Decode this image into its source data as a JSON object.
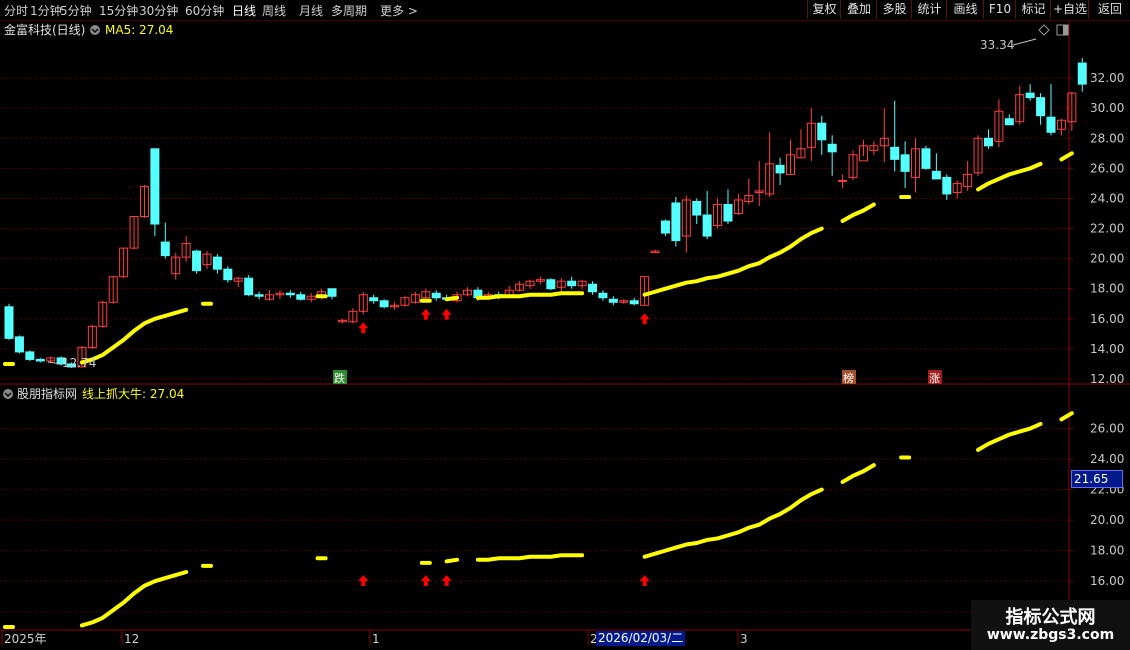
{
  "toolbar": {
    "tabs": [
      "分时",
      "1分钟",
      "5分钟",
      "15分钟",
      "30分钟",
      "60分钟",
      "日线",
      "周线",
      "月线",
      "多周期",
      "更多 >"
    ],
    "active_tab": "日线",
    "right_buttons": [
      "复权",
      "叠加",
      "多股",
      "统计",
      "画线",
      "F10",
      "标记",
      "+自选",
      "返回"
    ]
  },
  "main_panel": {
    "stock_title": "金富科技(日线)",
    "ma_label": "MA5: 27.04",
    "high_label": "33.34",
    "low_label": "12.74",
    "markers": [
      {
        "text": "跌",
        "color": "#2e8b2e"
      },
      {
        "text": "榜",
        "color": "#a0522d"
      },
      {
        "text": "涨",
        "color": "#a02020"
      }
    ]
  },
  "sub_panel": {
    "indicator_title": "股朋指标网",
    "line_label": "线上抓大牛: 27.04",
    "cursor_value": "21.65"
  },
  "x_axis": {
    "labels": [
      "2025年",
      "12",
      "1",
      "2",
      "3"
    ],
    "cursor_date": "2026/02/03/二"
  },
  "watermark": {
    "line1": "指标公式网",
    "line2": "www.zbgs3.com"
  },
  "colors": {
    "up": "#ff4040",
    "down": "#54ffff",
    "ma_line": "#ffff00",
    "signal": "#ff0000",
    "grid": "#5a0000"
  },
  "chart_data": [
    {
      "type": "candlestick",
      "title": "金富科技(日线)",
      "ylim": [
        11.8,
        34.4
      ],
      "y_ticks": [
        12.0,
        14.0,
        16.0,
        18.0,
        20.0,
        22.0,
        24.0,
        26.0,
        28.0,
        30.0,
        32.0
      ],
      "candles": [
        [
          16.8,
          14.7,
          17.0,
          14.6
        ],
        [
          14.8,
          13.8,
          14.9,
          13.7
        ],
        [
          13.8,
          13.3,
          13.9,
          13.2
        ],
        [
          13.3,
          13.2,
          13.4,
          13.1
        ],
        [
          13.2,
          13.4,
          13.5,
          13.1
        ],
        [
          13.4,
          13.0,
          13.5,
          12.9
        ],
        [
          13.0,
          12.8,
          13.1,
          12.74
        ],
        [
          12.8,
          14.1,
          14.2,
          12.8
        ],
        [
          14.1,
          15.5,
          15.6,
          14.0
        ],
        [
          15.5,
          17.1,
          17.2,
          15.4
        ],
        [
          17.1,
          18.8,
          18.8,
          17.0
        ],
        [
          18.8,
          20.7,
          20.7,
          18.7
        ],
        [
          20.7,
          22.8,
          22.8,
          20.6
        ],
        [
          22.8,
          24.8,
          24.9,
          22.7
        ],
        [
          27.3,
          22.3,
          27.3,
          21.5
        ],
        [
          21.1,
          20.2,
          22.4,
          20.0
        ],
        [
          19.0,
          20.1,
          20.4,
          18.6
        ],
        [
          20.1,
          21.0,
          21.5,
          19.8
        ],
        [
          20.5,
          19.2,
          20.6,
          19.0
        ],
        [
          19.6,
          20.3,
          20.5,
          19.3
        ],
        [
          20.1,
          19.3,
          20.3,
          19.0
        ],
        [
          19.3,
          18.6,
          19.5,
          18.4
        ],
        [
          18.5,
          18.7,
          18.8,
          18.1
        ],
        [
          18.7,
          17.6,
          18.9,
          17.5
        ],
        [
          17.6,
          17.5,
          17.8,
          17.3
        ],
        [
          17.3,
          17.6,
          17.9,
          17.2
        ],
        [
          17.6,
          17.7,
          17.9,
          17.3
        ],
        [
          17.7,
          17.6,
          17.9,
          17.4
        ],
        [
          17.6,
          17.3,
          17.8,
          17.2
        ],
        [
          17.3,
          17.5,
          17.7,
          17.1
        ],
        [
          17.5,
          17.8,
          18.0,
          17.3
        ],
        [
          18.0,
          17.5,
          18.0,
          17.3
        ],
        [
          15.8,
          15.9,
          16.0,
          15.7
        ],
        [
          15.8,
          16.5,
          16.7,
          15.7
        ],
        [
          16.5,
          17.6,
          17.8,
          16.3
        ],
        [
          17.4,
          17.2,
          17.6,
          17.0
        ],
        [
          17.2,
          16.8,
          17.3,
          16.7
        ],
        [
          16.8,
          16.9,
          17.1,
          16.6
        ],
        [
          16.9,
          17.4,
          17.5,
          16.8
        ],
        [
          17.1,
          17.6,
          17.8,
          17.0
        ],
        [
          17.4,
          17.8,
          18.0,
          17.2
        ],
        [
          17.7,
          17.4,
          17.9,
          17.2
        ],
        [
          17.4,
          17.3,
          17.6,
          17.2
        ],
        [
          17.2,
          17.6,
          17.8,
          17.1
        ],
        [
          17.6,
          17.9,
          18.1,
          17.5
        ],
        [
          17.9,
          17.4,
          18.1,
          17.2
        ],
        [
          17.5,
          17.6,
          17.8,
          17.3
        ],
        [
          17.6,
          17.5,
          17.8,
          17.3
        ],
        [
          17.5,
          17.9,
          18.2,
          17.4
        ],
        [
          17.9,
          18.3,
          18.5,
          17.8
        ],
        [
          18.2,
          18.5,
          18.6,
          18.0
        ],
        [
          18.5,
          18.6,
          18.8,
          18.3
        ],
        [
          18.6,
          18.0,
          18.7,
          17.9
        ],
        [
          18.1,
          18.5,
          18.7,
          17.8
        ],
        [
          18.5,
          18.2,
          18.8,
          18.0
        ],
        [
          18.2,
          18.5,
          18.6,
          18.0
        ],
        [
          18.3,
          17.8,
          18.5,
          17.6
        ],
        [
          17.7,
          17.4,
          17.9,
          17.2
        ],
        [
          17.3,
          17.1,
          17.5,
          16.9
        ],
        [
          17.1,
          17.2,
          17.3,
          17.0
        ],
        [
          17.2,
          17.0,
          17.4,
          16.9
        ],
        [
          16.9,
          18.8,
          18.8,
          16.9
        ],
        [
          20.4,
          20.5,
          20.6,
          20.4
        ],
        [
          22.5,
          21.7,
          22.6,
          21.5
        ],
        [
          23.7,
          21.2,
          24.1,
          20.8
        ],
        [
          21.5,
          23.9,
          24.2,
          20.4
        ],
        [
          23.8,
          22.9,
          24.0,
          22.3
        ],
        [
          22.9,
          21.5,
          24.5,
          21.3
        ],
        [
          22.2,
          23.6,
          24.0,
          22.0
        ],
        [
          23.6,
          22.5,
          24.6,
          22.3
        ],
        [
          23.0,
          23.9,
          24.3,
          22.9
        ],
        [
          23.8,
          24.2,
          25.3,
          23.6
        ],
        [
          24.4,
          24.5,
          26.5,
          23.5
        ],
        [
          24.3,
          26.3,
          28.4,
          24.1
        ],
        [
          26.2,
          25.7,
          26.7,
          24.9
        ],
        [
          25.6,
          26.9,
          27.9,
          25.6
        ],
        [
          26.7,
          27.3,
          28.6,
          26.7
        ],
        [
          27.4,
          29.0,
          30.0,
          26.5
        ],
        [
          29.0,
          27.9,
          29.5,
          26.9
        ],
        [
          27.6,
          27.1,
          28.2,
          25.5
        ],
        [
          25.2,
          25.2,
          25.6,
          24.7
        ],
        [
          25.4,
          26.9,
          27.2,
          25.2
        ],
        [
          26.5,
          27.5,
          27.9,
          26.8
        ],
        [
          27.2,
          27.5,
          27.8,
          26.9
        ],
        [
          27.5,
          28.0,
          30.0,
          26.4
        ],
        [
          27.4,
          26.6,
          30.5,
          25.8
        ],
        [
          26.9,
          25.8,
          27.8,
          24.7
        ],
        [
          25.4,
          27.3,
          28.0,
          24.4
        ],
        [
          27.3,
          26.0,
          27.5,
          25.9
        ],
        [
          25.8,
          25.3,
          27.0,
          25.3
        ],
        [
          25.4,
          24.3,
          25.6,
          23.9
        ],
        [
          24.4,
          25.0,
          25.2,
          24.0
        ],
        [
          24.8,
          25.6,
          26.5,
          24.5
        ],
        [
          25.7,
          28.0,
          28.2,
          25.5
        ],
        [
          28.0,
          27.5,
          28.6,
          27.3
        ],
        [
          27.8,
          29.8,
          30.6,
          27.4
        ],
        [
          29.3,
          28.9,
          29.6,
          28.9
        ],
        [
          29.1,
          30.9,
          31.5,
          28.9
        ],
        [
          31.0,
          30.7,
          31.6,
          30.5
        ],
        [
          30.7,
          29.5,
          31.0,
          28.9
        ],
        [
          29.4,
          28.4,
          31.6,
          28.2
        ],
        [
          28.6,
          29.2,
          29.3,
          28.2
        ],
        [
          29.1,
          31.0,
          31.1,
          28.5
        ],
        [
          33.0,
          31.6,
          33.34,
          31.1
        ]
      ],
      "ma_line": {
        "name": "MA5",
        "last_value": 27.04,
        "segments": [
          [
            [
              0,
              13.0
            ]
          ],
          [
            [
              7,
              13.1
            ],
            [
              8,
              13.3
            ],
            [
              9,
              13.6
            ],
            [
              10,
              14.1
            ],
            [
              11,
              14.6
            ],
            [
              12,
              15.2
            ],
            [
              13,
              15.7
            ],
            [
              14,
              16.0
            ],
            [
              15,
              16.2
            ],
            [
              16,
              16.4
            ],
            [
              17,
              16.6
            ]
          ],
          [
            [
              19,
              17.0
            ]
          ],
          [
            [
              30,
              17.5
            ]
          ],
          [
            [
              40,
              17.2
            ]
          ],
          [
            [
              42,
              17.3
            ],
            [
              43,
              17.4
            ]
          ],
          [
            [
              45,
              17.4
            ],
            [
              46,
              17.4
            ],
            [
              47,
              17.5
            ],
            [
              48,
              17.5
            ],
            [
              49,
              17.5
            ],
            [
              50,
              17.6
            ],
            [
              51,
              17.6
            ],
            [
              52,
              17.6
            ],
            [
              53,
              17.7
            ],
            [
              54,
              17.7
            ],
            [
              55,
              17.7
            ]
          ],
          [
            [
              61,
              17.6
            ],
            [
              62,
              17.8
            ],
            [
              63,
              18.0
            ],
            [
              64,
              18.2
            ],
            [
              65,
              18.4
            ],
            [
              66,
              18.5
            ],
            [
              67,
              18.7
            ],
            [
              68,
              18.8
            ],
            [
              69,
              19.0
            ],
            [
              70,
              19.2
            ],
            [
              71,
              19.5
            ],
            [
              72,
              19.7
            ],
            [
              73,
              20.1
            ],
            [
              74,
              20.4
            ],
            [
              75,
              20.8
            ],
            [
              76,
              21.3
            ],
            [
              77,
              21.7
            ],
            [
              78,
              22.0
            ]
          ],
          [
            [
              80,
              22.5
            ],
            [
              81,
              22.9
            ],
            [
              82,
              23.2
            ],
            [
              83,
              23.6
            ]
          ],
          [
            [
              86,
              24.1
            ]
          ],
          [
            [
              93,
              24.6
            ],
            [
              94,
              25.0
            ],
            [
              95,
              25.3
            ],
            [
              96,
              25.6
            ],
            [
              97,
              25.8
            ],
            [
              98,
              26.0
            ],
            [
              99,
              26.3
            ]
          ],
          [
            [
              101,
              26.6
            ],
            [
              102,
              27.0
            ]
          ]
        ]
      },
      "signals": [
        34,
        40,
        42,
        61
      ]
    },
    {
      "type": "line",
      "title": "股朋指标网",
      "series_name": "线上抓大牛",
      "ylim": [
        12.8,
        28.0
      ],
      "y_ticks": [
        14.0,
        16.0,
        18.0,
        20.0,
        22.0,
        24.0,
        26.0
      ],
      "cursor_value": 21.65
    }
  ]
}
